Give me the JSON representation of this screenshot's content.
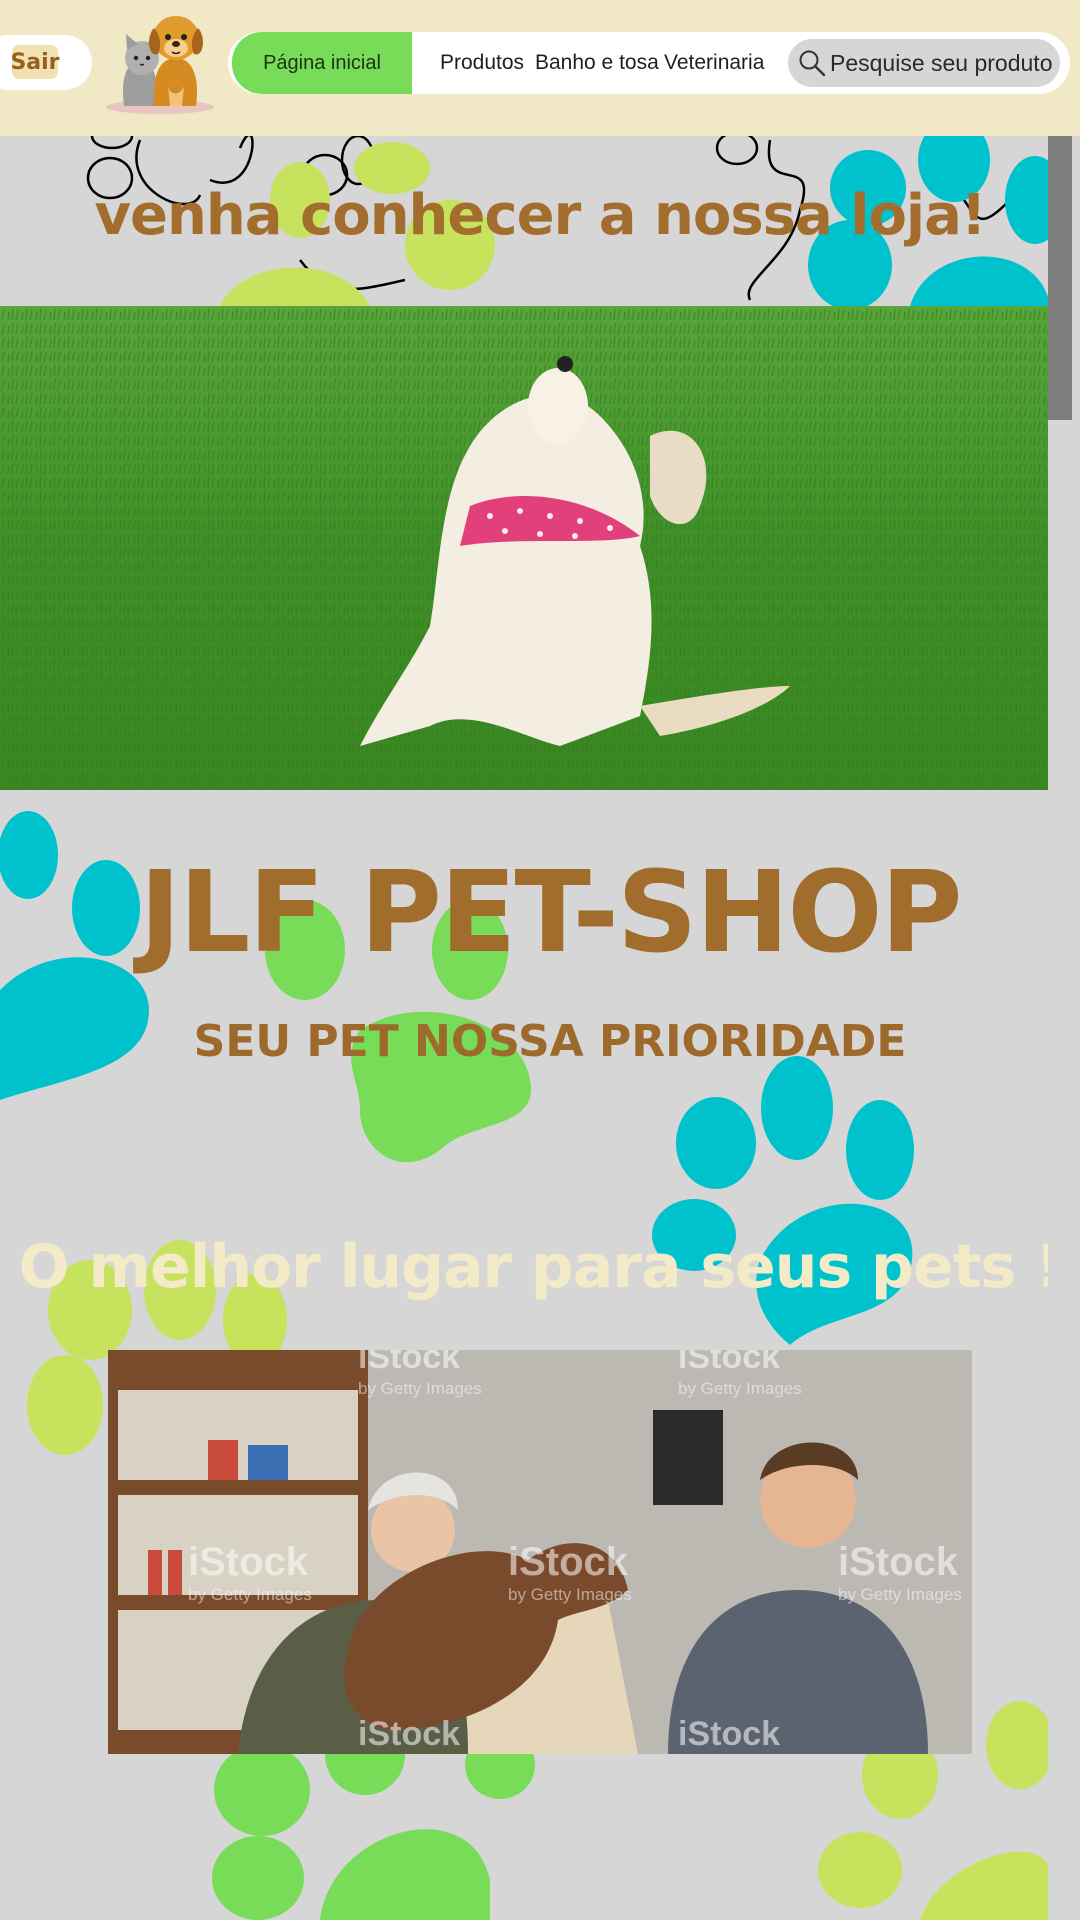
{
  "header": {
    "logout_label": "Sair",
    "logo": "dog-and-cat-logo",
    "nav": {
      "home": "Página inicial",
      "products": "Produtos",
      "grooming": "Banho e tosa",
      "vet": "Veterinaria"
    },
    "search": {
      "placeholder": "Pesquise seu produto",
      "icon": "search-icon"
    }
  },
  "section_intro": {
    "headline": "venha conhecer a nossa loja!"
  },
  "hero": {
    "image": "puppy-with-pink-bandana-on-grass"
  },
  "brand": {
    "title": "JLF PET-SHOP",
    "tagline": "SEU PET NOSSA PRIORIDADE"
  },
  "section_store": {
    "headline": "O melhor lugar para seus pets !",
    "image": "people-with-poodle-at-pet-shop-counter",
    "watermark_main": "iStock",
    "watermark_sub": "by Getty Images"
  },
  "colors": {
    "header_bg": "#f1e8c6",
    "nav_active": "#78dc58",
    "brand_brown": "#a06d2c",
    "page_bg": "#d6d6d6",
    "paw_cyan": "#00c2cd",
    "paw_green": "#78dc58",
    "paw_lime": "#c7e25c"
  }
}
